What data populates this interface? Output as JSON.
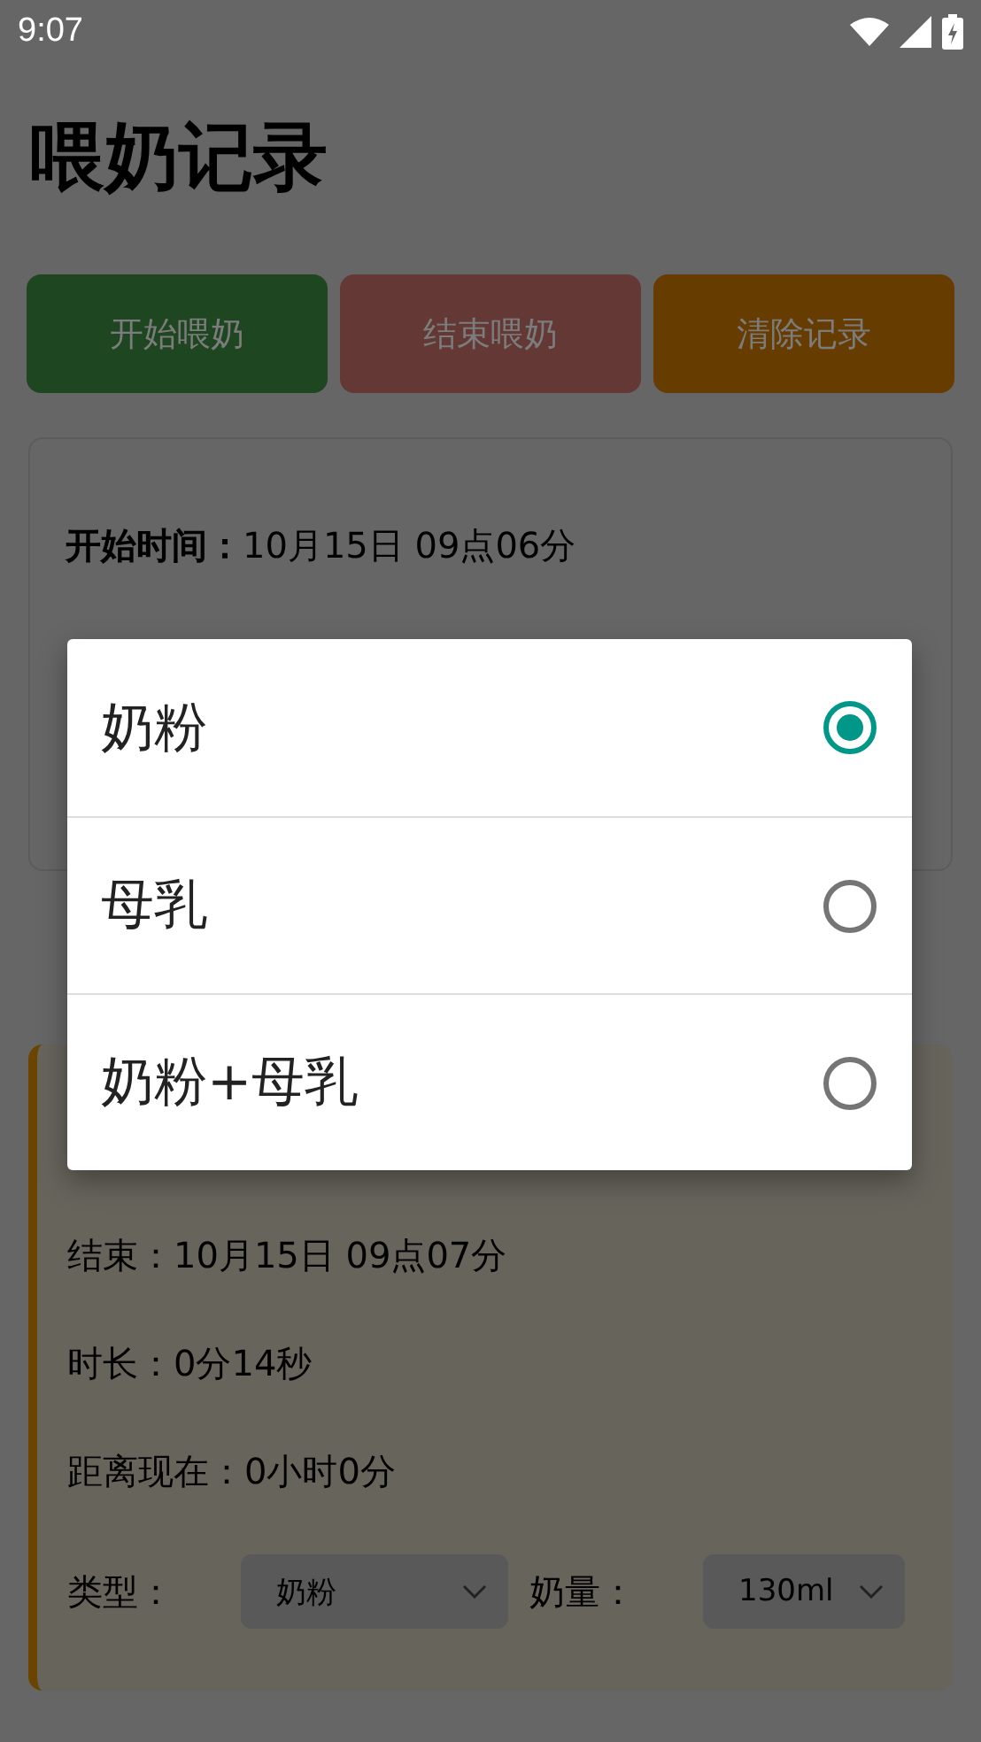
{
  "status_bar": {
    "time": "9:07"
  },
  "title": "喂奶记录",
  "buttons": [
    {
      "label": "开始喂奶",
      "kind": "start"
    },
    {
      "label": "结束喂奶",
      "kind": "end"
    },
    {
      "label": "清除记录",
      "kind": "clear"
    }
  ],
  "current_card": {
    "lines": [
      "**开始时间：**10月15日 09点06分"
    ]
  },
  "history_card": {
    "lines": [
      "结束：10月15日 09点07分",
      "时长：0分14秒",
      "距离现在：0小时0分"
    ],
    "type_label": "类型：",
    "type_value": "奶粉",
    "amount_label": "奶量：",
    "amount_value": "130ml"
  },
  "dialog": {
    "options": [
      {
        "label": "奶粉",
        "selected": true
      },
      {
        "label": "母乳",
        "selected": false
      },
      {
        "label": "奶粉+母乳",
        "selected": false
      }
    ]
  }
}
